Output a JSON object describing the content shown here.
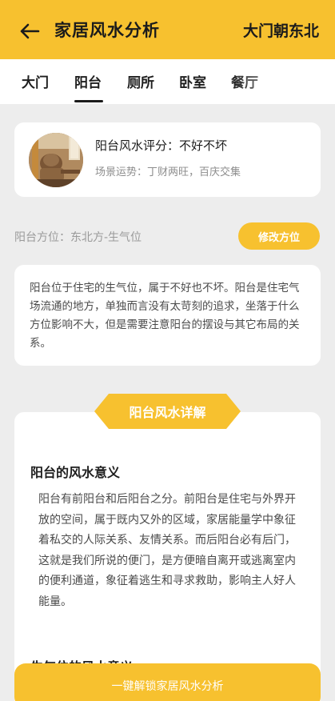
{
  "header": {
    "title": "家居风水分析",
    "door_direction": "大门朝东北"
  },
  "tabs": [
    "大门",
    "阳台",
    "厕所",
    "卧室",
    "餐厅"
  ],
  "active_tab": "阳台",
  "score_card": {
    "score": "阳台风水评分：不好不坏",
    "scene": "场景运势：丁财两旺，百庆交集"
  },
  "direction": {
    "label": "阳台方位：东北方-生气位",
    "modify_button": "修改方位"
  },
  "description": "阳台位于住宅的生气位，属于不好也不坏。阳台是住宅气场流通的地方，单独而言没有太苛刻的追求，坐落于什么方位影响不大，但是需要注意阳台的摆设与其它布局的关系。",
  "detail": {
    "badge": "阳台风水详解",
    "section_title": "阳台的风水意义",
    "section_body": "阳台有前阳台和后阳台之分。前阳台是住宅与外界开放的空间，属于既内又外的区域，家居能量学中象征着私交的人际关系、友情关系。而后阳台必有后门，这就是我们所说的便门，是方便暗自离开或逃离室内的便利通道，象征着逃生和寻求救助，影响主人好人能量。",
    "next_section_title": "生气位的风水意义"
  },
  "unlock_button": "一键解锁家居风水分析",
  "colors": {
    "accent": "#f7c12f",
    "background": "#ededed",
    "card": "#ffffff"
  }
}
